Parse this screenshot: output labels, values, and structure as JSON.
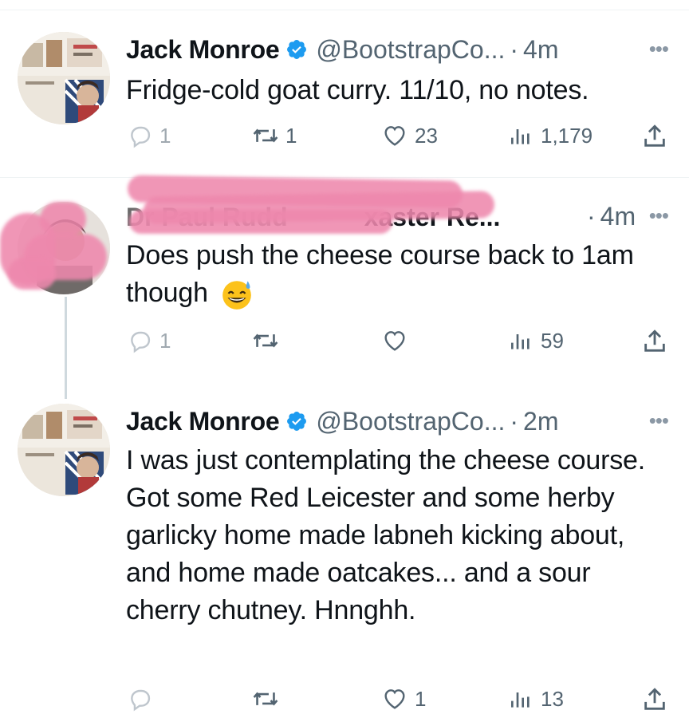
{
  "tweets": [
    {
      "name": "Jack Monroe",
      "handle": "@BootstrapCo...",
      "time": "4m",
      "more": "•••",
      "text": "Fridge-cold goat curry. 11/10, no notes.",
      "replies": "1",
      "retweets": "1",
      "likes": "23",
      "views": "1,179"
    },
    {
      "name": "Dr Paul Rudd... Brexaster Re...",
      "name_visible_suffix": "xaster Re...",
      "time": "4m",
      "more": "•••",
      "text": "Does push the cheese course back to 1am though",
      "emoji": "😅",
      "replies": "1",
      "retweets": "",
      "likes": "",
      "views": "59"
    },
    {
      "name": "Jack Monroe",
      "handle": "@BootstrapCo...",
      "time": "2m",
      "more": "•••",
      "text": "I was just contemplating the cheese course. Got some Red Leicester and some herby garlicky home made labneh kicking about, and home made oatcakes... and a sour cherry chutney. Hnnghh.",
      "replies": "",
      "retweets": "",
      "likes": "1",
      "views": "13"
    }
  ],
  "icons": {
    "reply": "reply-icon",
    "retweet": "retweet-icon",
    "like": "heart-icon",
    "views": "views-icon",
    "share": "share-icon",
    "verified": "verified-badge-icon"
  },
  "colors": {
    "verified": "#1d9bf0",
    "muted": "#536471",
    "redaction": "#ee88ad"
  }
}
